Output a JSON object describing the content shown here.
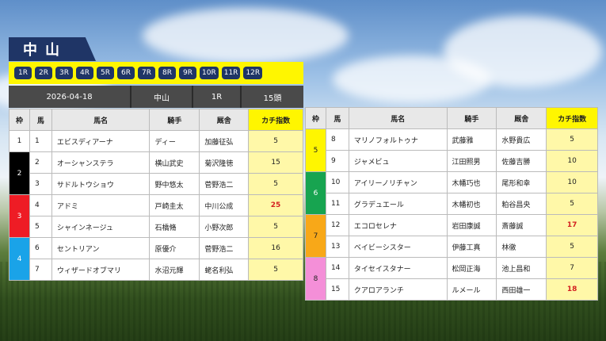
{
  "venue": "中山",
  "race_buttons": [
    "1R",
    "2R",
    "3R",
    "4R",
    "5R",
    "6R",
    "7R",
    "8R",
    "9R",
    "10R",
    "11R",
    "12R"
  ],
  "info": {
    "date": "2026-04-18",
    "place": "中山",
    "race": "1R",
    "heads": "15頭"
  },
  "headers": {
    "waku": "枠",
    "uma": "馬",
    "name": "馬名",
    "jockey": "騎手",
    "stable": "厩舎",
    "score": "カチ指数"
  },
  "colors": {
    "w1": "#ffffff",
    "w2": "#000000",
    "w3": "#ee1c25",
    "w4": "#1aa3e8",
    "w5": "#fff600",
    "w6": "#17a450",
    "w7": "#f8a818",
    "w8": "#f48fd8"
  },
  "left_rows": [
    {
      "waku": "1",
      "uma": "1",
      "name": "エビスディアーナ",
      "jockey": "ディー",
      "stable": "加藤征弘",
      "score": "5"
    },
    {
      "waku": "2",
      "uma": "2",
      "name": "オーシャンステラ",
      "jockey": "横山武史",
      "stable": "菊沢隆徳",
      "score": "15"
    },
    {
      "waku": "",
      "uma": "3",
      "name": "サドルトウショウ",
      "jockey": "野中悠太",
      "stable": "菅野浩二",
      "score": "5"
    },
    {
      "waku": "3",
      "uma": "4",
      "name": "アドミ",
      "jockey": "戸崎圭太",
      "stable": "中川公成",
      "score": "25"
    },
    {
      "waku": "",
      "uma": "5",
      "name": "シャインネージュ",
      "jockey": "石橋脩",
      "stable": "小野次郎",
      "score": "5"
    },
    {
      "waku": "4",
      "uma": "6",
      "name": "セントリアン",
      "jockey": "原優介",
      "stable": "菅野浩二",
      "score": "16"
    },
    {
      "waku": "",
      "uma": "7",
      "name": "ウィザードオブマリ",
      "jockey": "水沼元輝",
      "stable": "蛯名利弘",
      "score": "5"
    }
  ],
  "right_rows": [
    {
      "waku": "5",
      "uma": "8",
      "name": "マリノフォルトゥナ",
      "jockey": "武藤雅",
      "stable": "水野貴広",
      "score": "5"
    },
    {
      "waku": "",
      "uma": "9",
      "name": "ジャメビュ",
      "jockey": "江田照男",
      "stable": "佐藤吉勝",
      "score": "10"
    },
    {
      "waku": "6",
      "uma": "10",
      "name": "アイリーノリチャン",
      "jockey": "木幡巧也",
      "stable": "尾形和幸",
      "score": "10"
    },
    {
      "waku": "",
      "uma": "11",
      "name": "グラデュエール",
      "jockey": "木幡初也",
      "stable": "粕谷昌央",
      "score": "5"
    },
    {
      "waku": "7",
      "uma": "12",
      "name": "エコロセレナ",
      "jockey": "岩田康誠",
      "stable": "斎藤誠",
      "score": "17"
    },
    {
      "waku": "",
      "uma": "13",
      "name": "ベイビーシスター",
      "jockey": "伊藤工真",
      "stable": "林徹",
      "score": "5"
    },
    {
      "waku": "8",
      "uma": "14",
      "name": "タイセイスタナー",
      "jockey": "松岡正海",
      "stable": "池上昌和",
      "score": "7"
    },
    {
      "waku": "",
      "uma": "15",
      "name": "クアロアランチ",
      "jockey": "ルメール",
      "stable": "西田雄一",
      "score": "18"
    }
  ]
}
